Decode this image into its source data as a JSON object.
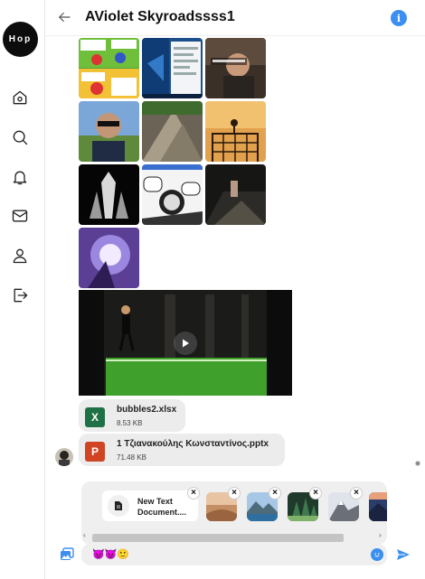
{
  "app": {
    "logo_text": "Hop"
  },
  "sidebar": {
    "items": [
      {
        "name": "home",
        "icon": "home-icon"
      },
      {
        "name": "search",
        "icon": "search-icon"
      },
      {
        "name": "notifications",
        "icon": "bell-icon"
      },
      {
        "name": "messages",
        "icon": "mail-icon"
      },
      {
        "name": "profile",
        "icon": "user-icon"
      },
      {
        "name": "logout",
        "icon": "logout-icon"
      }
    ]
  },
  "header": {
    "title": "AViolet Skyroadssss1",
    "info_icon": "info-icon",
    "back_icon": "arrow-left-icon"
  },
  "messages": {
    "images": [
      {
        "id": "comic-strip"
      },
      {
        "id": "desktop-screenshot"
      },
      {
        "id": "man-talking"
      },
      {
        "id": "selfie-sunglasses"
      },
      {
        "id": "rock-wall"
      },
      {
        "id": "climbing-tower"
      },
      {
        "id": "dark-figure"
      },
      {
        "id": "manga-panel"
      },
      {
        "id": "dark-scene"
      },
      {
        "id": "anime-glow"
      }
    ],
    "video": {
      "play_icon": "play-icon"
    },
    "files": [
      {
        "name": "bubbles2.xlsx",
        "size": "8.53 KB",
        "type": "xlsx",
        "icon_letter": "X",
        "color": "#1e7145"
      },
      {
        "name": "1 Τζιανακούλης Κωνσταντίνος.pptx",
        "size": "71.48 KB",
        "type": "pptx",
        "icon_letter": "P",
        "color": "#d04423"
      }
    ]
  },
  "composer": {
    "draft_doc": "New Text Document....",
    "remove_label": "×",
    "input_value": "😈😈🙂",
    "accent_color": "#3b8ff0",
    "scroll_left": "‹",
    "scroll_right": "›"
  }
}
